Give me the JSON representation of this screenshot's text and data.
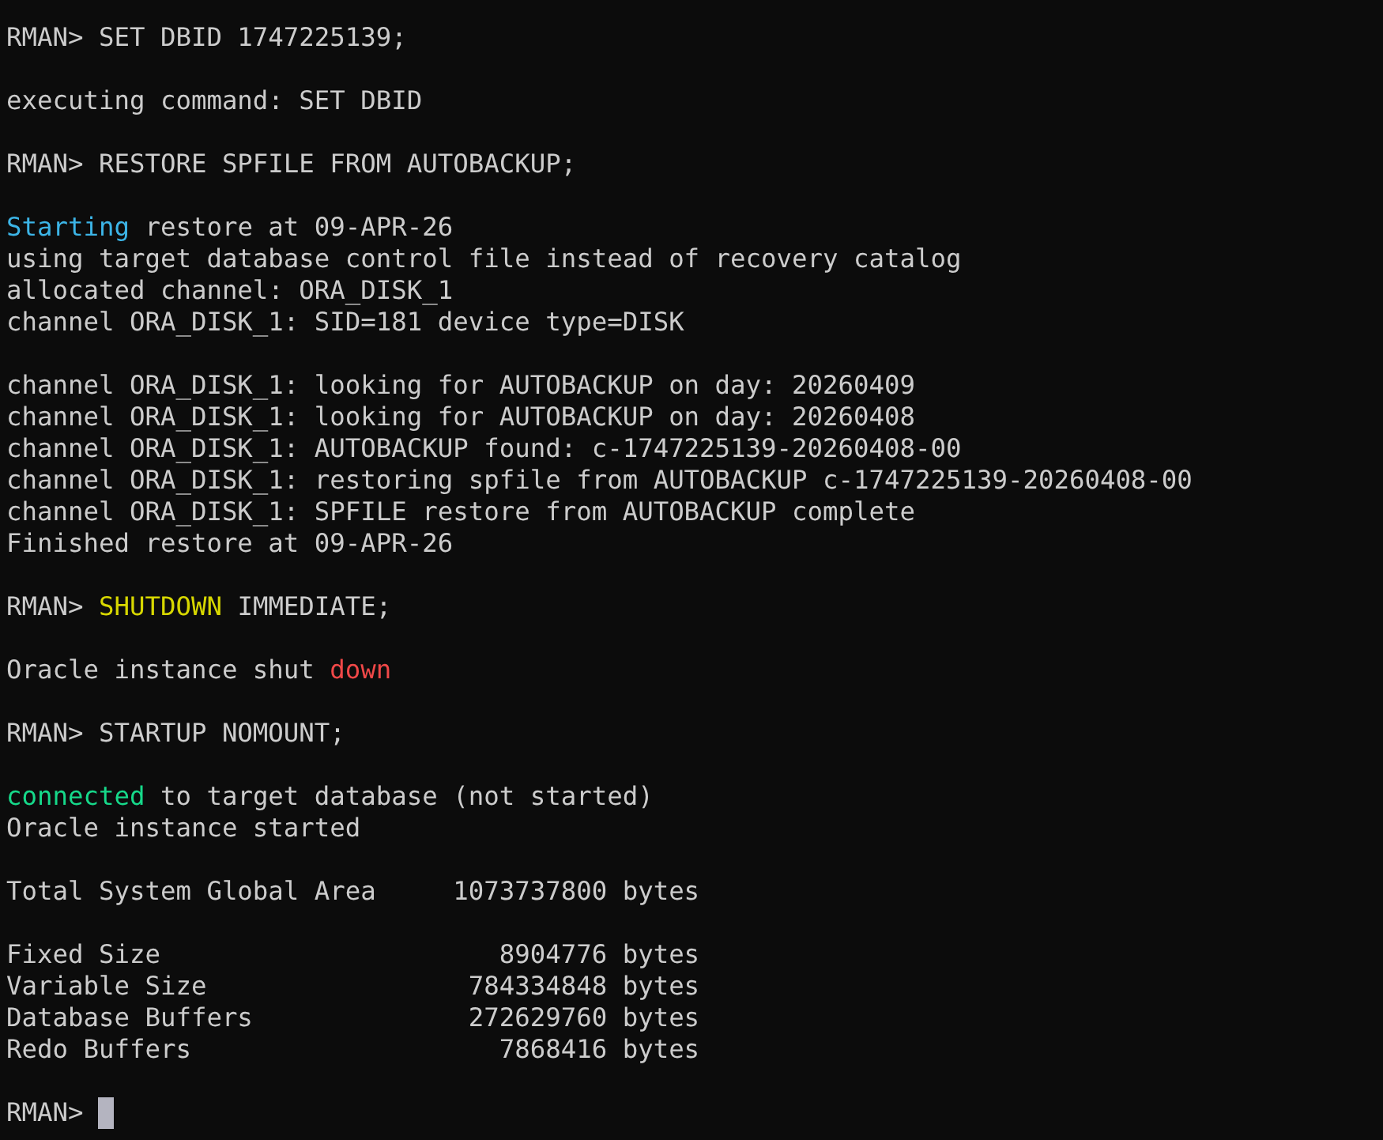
{
  "terminal": {
    "lines": [
      {
        "kind": "text",
        "segments": [
          {
            "text": "RMAN> SET DBID 1747225139;"
          }
        ]
      },
      {
        "kind": "blank"
      },
      {
        "kind": "text",
        "segments": [
          {
            "text": "executing command: SET DBID"
          }
        ]
      },
      {
        "kind": "blank"
      },
      {
        "kind": "text",
        "segments": [
          {
            "text": "RMAN> RESTORE SPFILE FROM AUTOBACKUP;"
          }
        ]
      },
      {
        "kind": "blank"
      },
      {
        "kind": "text",
        "segments": [
          {
            "text": "Starting",
            "color": "#3cb4e6"
          },
          {
            "text": " restore at 09-APR-26"
          }
        ]
      },
      {
        "kind": "text",
        "segments": [
          {
            "text": "using target database control file instead of recovery catalog"
          }
        ]
      },
      {
        "kind": "text",
        "segments": [
          {
            "text": "allocated channel: ORA_DISK_1"
          }
        ]
      },
      {
        "kind": "text",
        "segments": [
          {
            "text": "channel ORA_DISK_1: SID=181 device type=DISK"
          }
        ]
      },
      {
        "kind": "blank"
      },
      {
        "kind": "text",
        "segments": [
          {
            "text": "channel ORA_DISK_1: looking for AUTOBACKUP on day: 20260409"
          }
        ]
      },
      {
        "kind": "text",
        "segments": [
          {
            "text": "channel ORA_DISK_1: looking for AUTOBACKUP on day: 20260408"
          }
        ]
      },
      {
        "kind": "text",
        "segments": [
          {
            "text": "channel ORA_DISK_1: AUTOBACKUP found: c-1747225139-20260408-00"
          }
        ]
      },
      {
        "kind": "text",
        "segments": [
          {
            "text": "channel ORA_DISK_1: restoring spfile from AUTOBACKUP c-1747225139-20260408-00"
          }
        ]
      },
      {
        "kind": "text",
        "segments": [
          {
            "text": "channel ORA_DISK_1: SPFILE restore from AUTOBACKUP complete"
          }
        ]
      },
      {
        "kind": "text",
        "segments": [
          {
            "text": "Finished restore at 09-APR-26"
          }
        ]
      },
      {
        "kind": "blank"
      },
      {
        "kind": "text",
        "segments": [
          {
            "text": "RMAN> "
          },
          {
            "text": "SHUTDOWN",
            "color": "#d7d700"
          },
          {
            "text": " IMMEDIATE;"
          }
        ]
      },
      {
        "kind": "blank"
      },
      {
        "kind": "text",
        "segments": [
          {
            "text": "Oracle instance shut "
          },
          {
            "text": "down",
            "color": "#f04848"
          }
        ]
      },
      {
        "kind": "blank"
      },
      {
        "kind": "text",
        "segments": [
          {
            "text": "RMAN> STARTUP NOMOUNT;"
          }
        ]
      },
      {
        "kind": "blank"
      },
      {
        "kind": "text",
        "segments": [
          {
            "text": "connected",
            "color": "#16d98a"
          },
          {
            "text": " to target database (not started)"
          }
        ]
      },
      {
        "kind": "text",
        "segments": [
          {
            "text": "Oracle instance started"
          }
        ]
      },
      {
        "kind": "blank"
      },
      {
        "kind": "text",
        "segments": [
          {
            "text": "Total System Global Area     1073737800 bytes"
          }
        ]
      },
      {
        "kind": "blank"
      },
      {
        "kind": "text",
        "segments": [
          {
            "text": "Fixed Size                      8904776 bytes"
          }
        ]
      },
      {
        "kind": "text",
        "segments": [
          {
            "text": "Variable Size                 784334848 bytes"
          }
        ]
      },
      {
        "kind": "text",
        "segments": [
          {
            "text": "Database Buffers              272629760 bytes"
          }
        ]
      },
      {
        "kind": "text",
        "segments": [
          {
            "text": "Redo Buffers                    7868416 bytes"
          }
        ]
      },
      {
        "kind": "blank"
      },
      {
        "kind": "prompt",
        "segments": [
          {
            "text": "RMAN> "
          }
        ]
      }
    ]
  }
}
